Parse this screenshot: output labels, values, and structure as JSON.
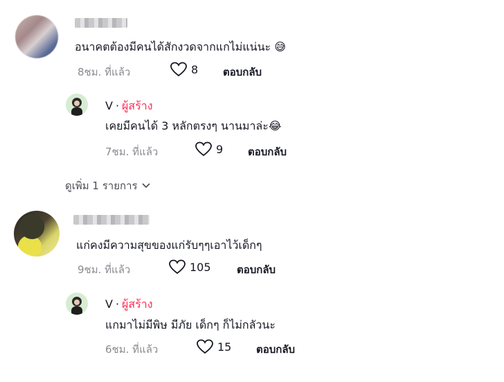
{
  "comments": [
    {
      "text": "อนาคตต้องมีคนได้สักงวดจากแกไม่แน่นะ",
      "emoji": "😅",
      "time": "8ชม. ที่แล้ว",
      "likes": "8",
      "reply_label": "ตอบกลับ",
      "reply": {
        "author": "V",
        "separator": "·",
        "badge": "ผู้สร้าง",
        "text": "เคยมีคนได้ 3 หลักตรงๆ นานมาล่ะ",
        "emoji": "😂",
        "time": "7ชม. ที่แล้ว",
        "likes": "9",
        "reply_label": "ตอบกลับ"
      },
      "more_label": "ดูเพิ่ม 1 รายการ"
    },
    {
      "text": "แก่คงมีความสุขของแก่รับๆๆเอาไว้เด็กๆ",
      "time": "9ชม. ที่แล้ว",
      "likes": "105",
      "reply_label": "ตอบกลับ",
      "reply": {
        "author": "V",
        "separator": "·",
        "badge": "ผู้สร้าง",
        "text": "แกมาไม่มีพิษ มีภัย เด็กๆ ก็ไม่กลัวนะ",
        "time": "6ชม. ที่แล้ว",
        "likes": "15",
        "reply_label": "ตอบกลับ"
      }
    }
  ],
  "colors": {
    "badge": "#fe2c55",
    "meta": "#8a8b91",
    "text": "#161823"
  }
}
